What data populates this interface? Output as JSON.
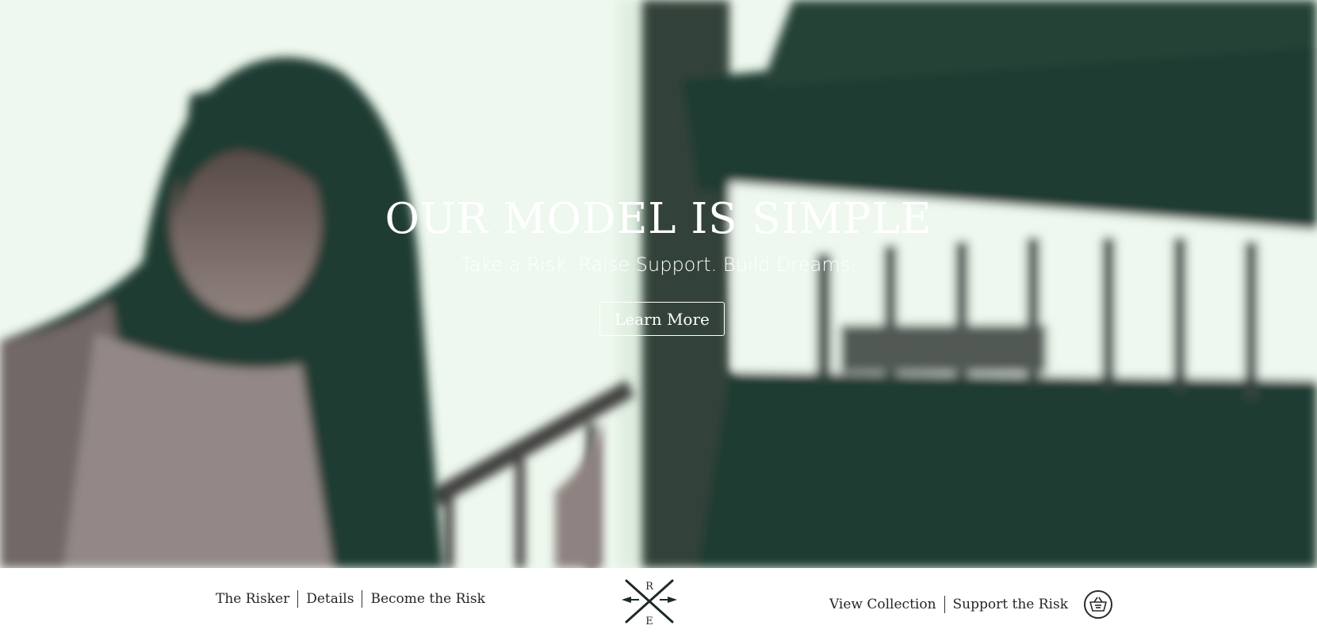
{
  "hero": {
    "title": "OUR MODEL IS SIMPLE",
    "subtitle": "Take a Risk. Raise Support. Build Dreams.",
    "cta_label": "Learn More"
  },
  "nav": {
    "left_links": [
      "The Risker",
      "Details",
      "Become the Risk"
    ],
    "right_links": [
      "View Collection",
      "Support the Risk"
    ],
    "logo_letters": {
      "top": "R",
      "bottom": "E"
    }
  },
  "icons": {
    "cart": "shopping-basket-icon",
    "logo": "crossed-arrows-logo"
  },
  "colors": {
    "hero_dark": "#16342a",
    "hero_light": "#eef8ee",
    "hero_mid": "#7b6f6c",
    "nav_text": "#262626"
  }
}
